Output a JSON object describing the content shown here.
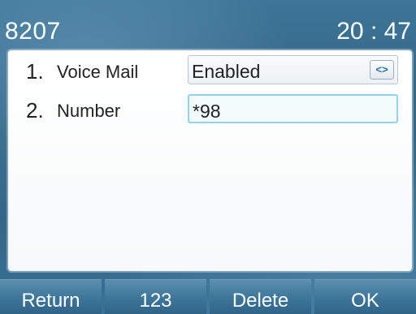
{
  "status_bar": {
    "line": "8207",
    "time": "20 : 47"
  },
  "settings": [
    {
      "index": "1.",
      "label": "Voice Mail",
      "value": "Enabled",
      "control": "left-right-arrows-icon"
    },
    {
      "index": "2.",
      "label": "Number",
      "value": "*98"
    }
  ],
  "softkeys": [
    "Return",
    "123",
    "Delete",
    "OK"
  ]
}
